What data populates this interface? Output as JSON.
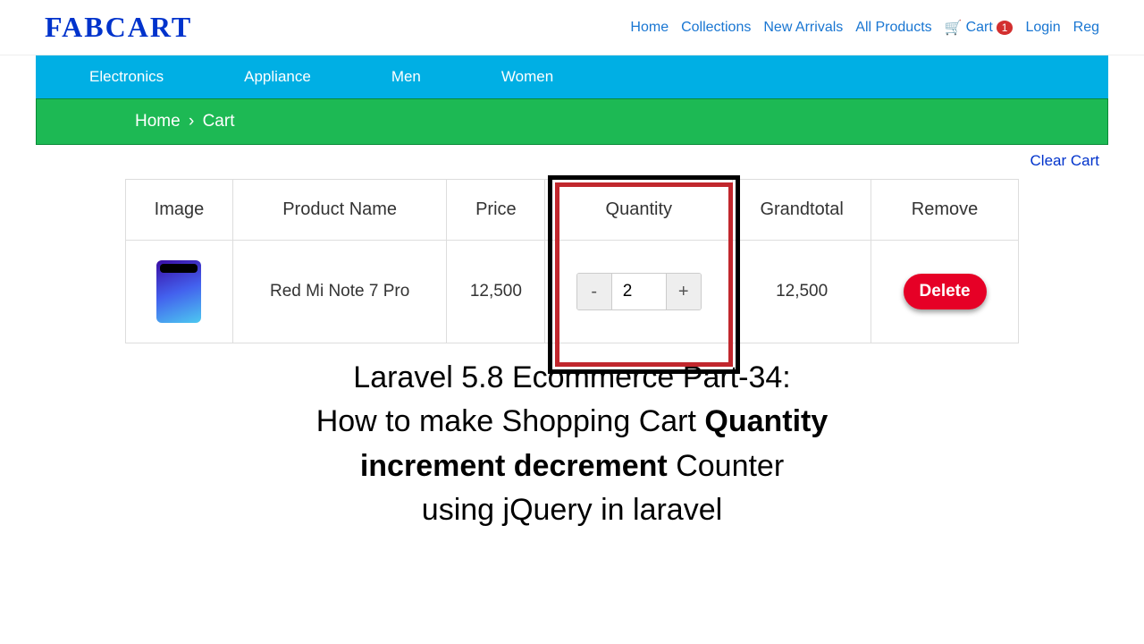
{
  "header": {
    "logo": "FABCART",
    "nav": {
      "home": "Home",
      "collections": "Collections",
      "new_arrivals": "New Arrivals",
      "all_products": "All Products",
      "cart_label": "Cart",
      "cart_count": "1",
      "login": "Login",
      "reg": "Reg"
    }
  },
  "categories": {
    "electronics": "Electronics",
    "appliance": "Appliance",
    "men": "Men",
    "women": "Women"
  },
  "breadcrumb": {
    "home": "Home",
    "sep": "›",
    "current": "Cart"
  },
  "actions": {
    "clear_cart": "Clear Cart"
  },
  "table": {
    "headers": {
      "image": "Image",
      "name": "Product Name",
      "price": "Price",
      "qty": "Quantity",
      "total": "Grandtotal",
      "remove": "Remove"
    },
    "row": {
      "name": "Red Mi Note 7 Pro",
      "price": "12,500",
      "qty": "2",
      "total": "12,500",
      "delete": "Delete"
    },
    "stepper": {
      "minus": "-",
      "plus": "+"
    }
  },
  "caption": {
    "line1": "Laravel 5.8 Ecommerce Part-34:",
    "line2a": "How to make Shopping Cart ",
    "line2b": "Quantity",
    "line3a": "increment decrement",
    "line3b": " Counter",
    "line4": "using jQuery in laravel"
  }
}
